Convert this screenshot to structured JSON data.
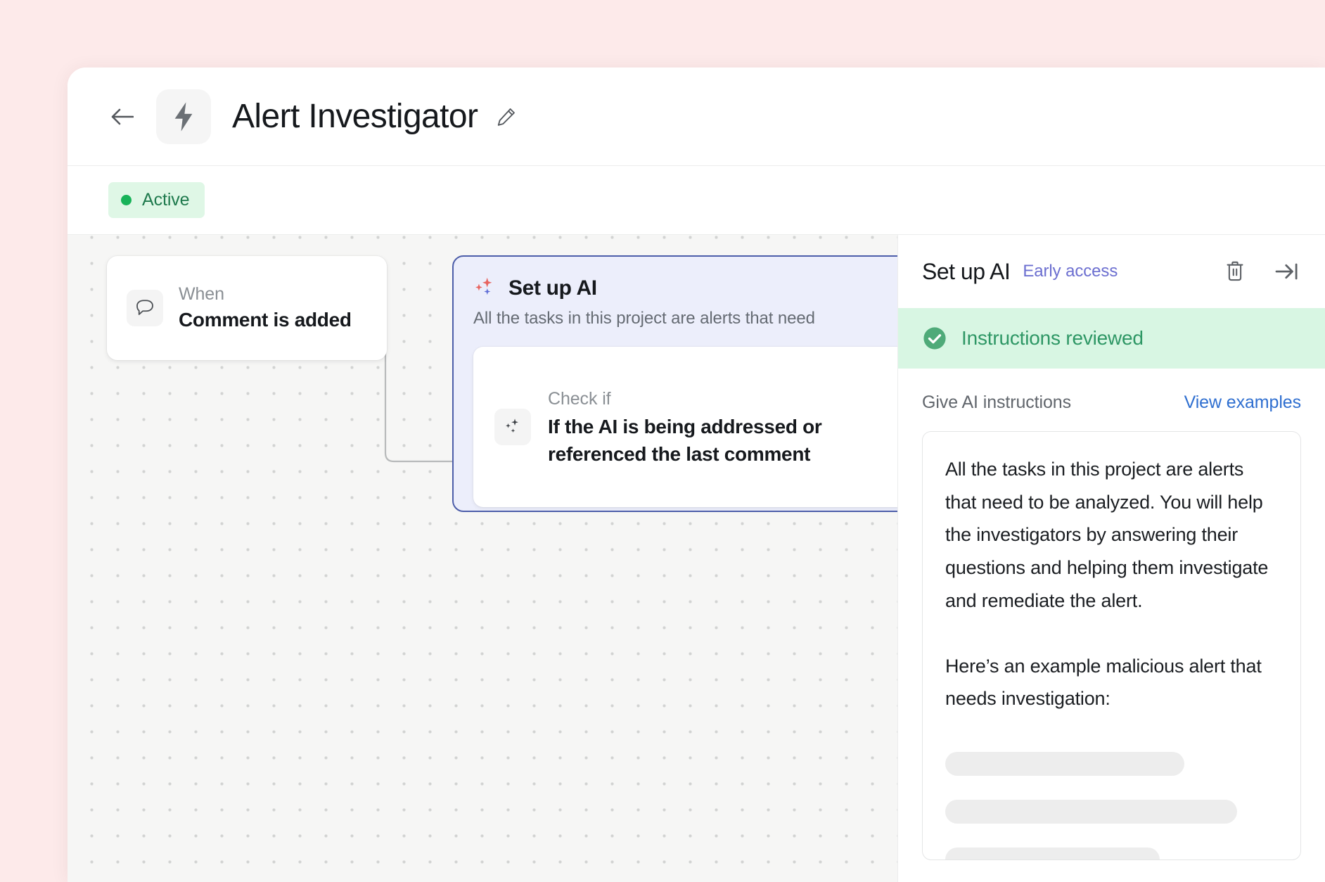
{
  "window": {
    "titlebar": {
      "back_icon": "arrow-left-icon",
      "app_icon": "lightning-bolt-icon",
      "title": "Alert Investigator",
      "edit_icon": "pencil-icon"
    },
    "statusbar": {
      "status_label": "Active",
      "status_color": "#18b359",
      "status_bg": "#dff7e6"
    }
  },
  "canvas": {
    "trigger_node": {
      "icon": "comment-bubble-icon",
      "eyebrow": "When",
      "title": "Comment is added"
    },
    "ai_node": {
      "icon": "sparkles-icon",
      "title": "Set up AI",
      "subtitle": "All the tasks in this project are alerts that need",
      "border_color": "#4c5da9",
      "bg_color": "#eceefb",
      "subcard": {
        "icon": "sparkles-icon",
        "eyebrow": "Check if",
        "title": "If the AI is being addressed or referenced the last comment"
      }
    }
  },
  "panel": {
    "title": "Set up AI",
    "tag": "Early access",
    "tag_color": "#6c6fd0",
    "delete_icon": "trash-icon",
    "collapse_icon": "arrow-right-to-line-icon",
    "banner": {
      "icon": "check-circle-icon",
      "text": "Instructions reviewed",
      "bg_color": "#d8f6e3",
      "text_color": "#2e9765"
    },
    "instructions": {
      "label": "Give AI instructions",
      "examples_link": "View examples",
      "link_color": "#2f6fd0",
      "paragraphs": [
        "All the tasks in this project are alerts that need to be analyzed. You will help the investigators by answering their questions and helping them investigate and remediate the alert.",
        "Here’s an example malicious alert that needs investigation:"
      ],
      "skeleton_widths": [
        "340px",
        "415px",
        "305px"
      ]
    }
  }
}
